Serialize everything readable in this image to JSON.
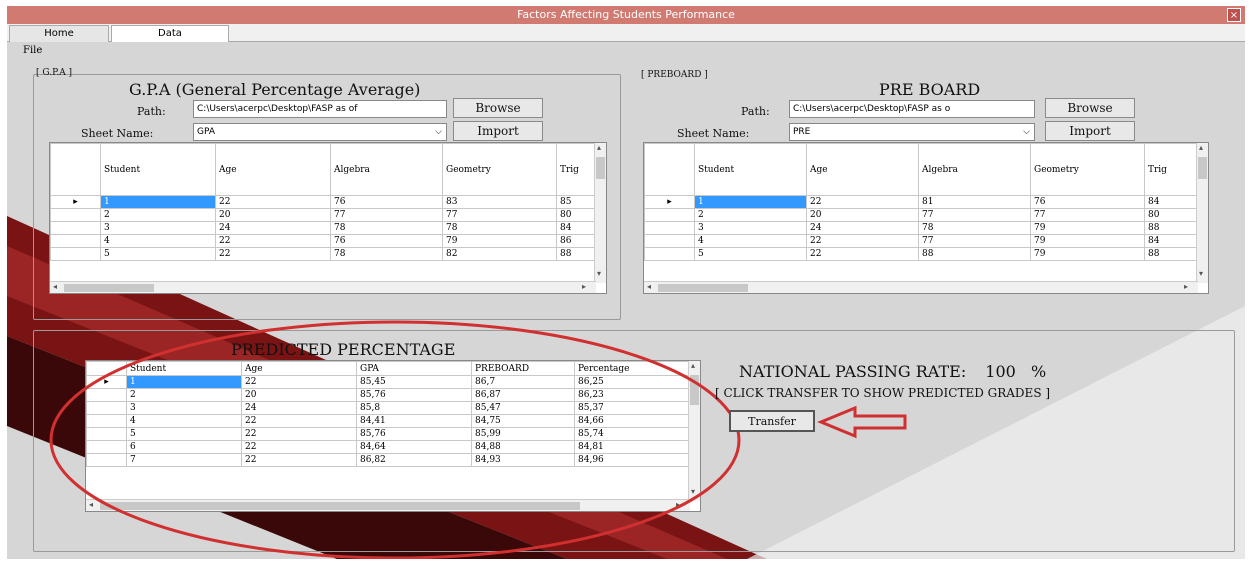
{
  "window": {
    "title": "Factors Affecting Students Performance",
    "close": "×"
  },
  "tabs": [
    "Home",
    "Data"
  ],
  "menu": {
    "file": "File"
  },
  "gpa": {
    "group_label": "[ G.P.A ]",
    "heading": "G.P.A (General Percentage Average)",
    "path_label": "Path:",
    "path_value": "C:\\Users\\acerpc\\Desktop\\FASP as of",
    "browse": "Browse",
    "sheet_label": "Sheet Name:",
    "sheet_value": "GPA",
    "import": "Import",
    "columns": [
      "Student",
      "Age",
      "Algebra",
      "Geometry",
      "Trig"
    ],
    "rows": [
      [
        "1",
        "22",
        "76",
        "83",
        "85"
      ],
      [
        "2",
        "20",
        "77",
        "77",
        "80"
      ],
      [
        "3",
        "24",
        "78",
        "78",
        "84"
      ],
      [
        "4",
        "22",
        "76",
        "79",
        "86"
      ],
      [
        "5",
        "22",
        "78",
        "82",
        "88"
      ]
    ]
  },
  "pre": {
    "group_label": "[ PREBOARD ]",
    "heading": "PRE BOARD",
    "path_label": "Path:",
    "path_value": "C:\\Users\\acerpc\\Desktop\\FASP as o",
    "browse": "Browse",
    "sheet_label": "Sheet Name:",
    "sheet_value": "PRE",
    "import": "Import",
    "columns": [
      "Student",
      "Age",
      "Algebra",
      "Geometry",
      "Trig"
    ],
    "rows": [
      [
        "1",
        "22",
        "81",
        "76",
        "84"
      ],
      [
        "2",
        "20",
        "77",
        "77",
        "80"
      ],
      [
        "3",
        "24",
        "78",
        "79",
        "88"
      ],
      [
        "4",
        "22",
        "77",
        "79",
        "84"
      ],
      [
        "5",
        "22",
        "88",
        "79",
        "88"
      ]
    ]
  },
  "predicted": {
    "heading": "PREDICTED PERCENTAGE",
    "columns": [
      "Student",
      "Age",
      "GPA",
      "PREBOARD",
      "Percentage"
    ],
    "rows": [
      [
        "1",
        "22",
        "85,45",
        "86,7",
        "86,25"
      ],
      [
        "2",
        "20",
        "85,76",
        "86,87",
        "86,23"
      ],
      [
        "3",
        "24",
        "85,8",
        "85,47",
        "85,37"
      ],
      [
        "4",
        "22",
        "84,41",
        "84,75",
        "84,66"
      ],
      [
        "5",
        "22",
        "85,76",
        "85,99",
        "85,74"
      ],
      [
        "6",
        "22",
        "84,64",
        "84,88",
        "84,81"
      ],
      [
        "7",
        "22",
        "86,82",
        "84,93",
        "84,96"
      ]
    ]
  },
  "national": {
    "label": "NATIONAL PASSING RATE:",
    "value": "100",
    "unit": "%",
    "hint": "[ CLICK TRANSFER TO SHOW PREDICTED GRADES ]",
    "transfer": "Transfer"
  },
  "colors": {
    "title_bar": "#d07a72",
    "annotation_red": "#d03030",
    "selection": "#3399ff",
    "stripe": "#7a1414"
  }
}
